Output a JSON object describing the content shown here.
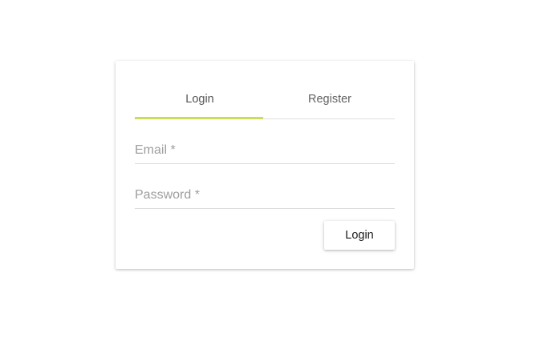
{
  "tabs": [
    {
      "label": "Login",
      "active": true
    },
    {
      "label": "Register",
      "active": false
    }
  ],
  "form": {
    "email_label": "Email *",
    "password_label": "Password *",
    "submit_label": "Login"
  },
  "colors": {
    "tab_indicator": "#cddc5b",
    "background": "#ffffff"
  }
}
